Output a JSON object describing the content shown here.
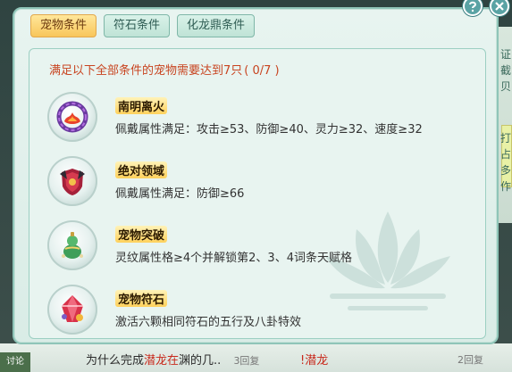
{
  "tabs": [
    {
      "label": "宠物条件",
      "active": true
    },
    {
      "label": "符石条件",
      "active": false
    },
    {
      "label": "化龙鼎条件",
      "active": false
    }
  ],
  "headline": {
    "text": "满足以下全部条件的宠物需要达到7只",
    "count": "( 0/7 )"
  },
  "conditions": [
    {
      "name": "南明离火",
      "desc": "佩戴属性满足：攻击≥53、防御≥40、灵力≥32、速度≥32",
      "icon": "fire-ring-icon"
    },
    {
      "name": "绝对领域",
      "desc": "佩戴属性满足：防御≥66",
      "icon": "shield-armor-icon"
    },
    {
      "name": "宠物突破",
      "desc": "灵纹属性格≥4个并解锁第2、3、4词条天赋格",
      "icon": "jade-gourd-icon"
    },
    {
      "name": "宠物符石",
      "desc": "激活六颗相同符石的五行及八卦特效",
      "icon": "rune-gem-icon"
    }
  ],
  "background": {
    "row1": {
      "prefix": "为什么完成",
      "highlight": "潜龙在",
      "suffix": "渊的几..",
      "meta": "3回复"
    },
    "row2": {
      "text": "!潜龙",
      "meta": "2回复"
    },
    "left_tab": "讨论",
    "edge_chars": [
      "证",
      "截",
      "贝",
      "打",
      "占",
      "多",
      "作"
    ]
  },
  "colors": {
    "accent": "#c84420",
    "active_tab": "#f8c65b",
    "panel": "#e8f4f0",
    "border": "#8fc5b8"
  }
}
